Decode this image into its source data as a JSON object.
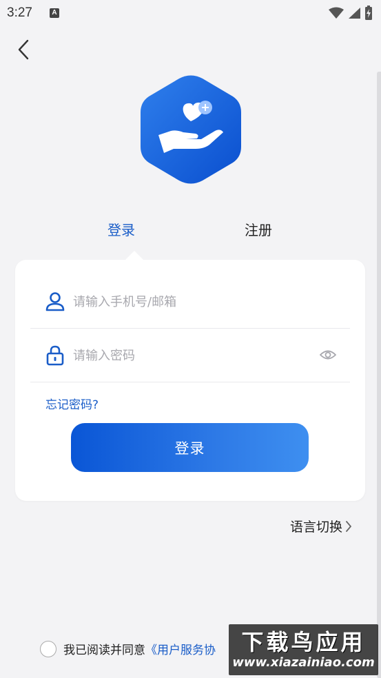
{
  "status_bar": {
    "time": "3:27",
    "notification_letter": "A"
  },
  "tabs": {
    "login": "登录",
    "register": "注册"
  },
  "form": {
    "phone_placeholder": "请输入手机号/邮箱",
    "password_placeholder": "请输入密码",
    "forgot_password": "忘记密码?",
    "login_button": "登录"
  },
  "language_switch": "语言切换",
  "agreement": {
    "prefix": "我已阅读并同意",
    "link": "《用户服务协"
  },
  "watermark": {
    "title": "下载鸟应用",
    "url": "www.xiazainiao.com"
  },
  "colors": {
    "accent": "#1a5dc8",
    "background": "#f3f3f5",
    "button_start": "#0a56d6",
    "button_end": "#3e8ff0"
  }
}
